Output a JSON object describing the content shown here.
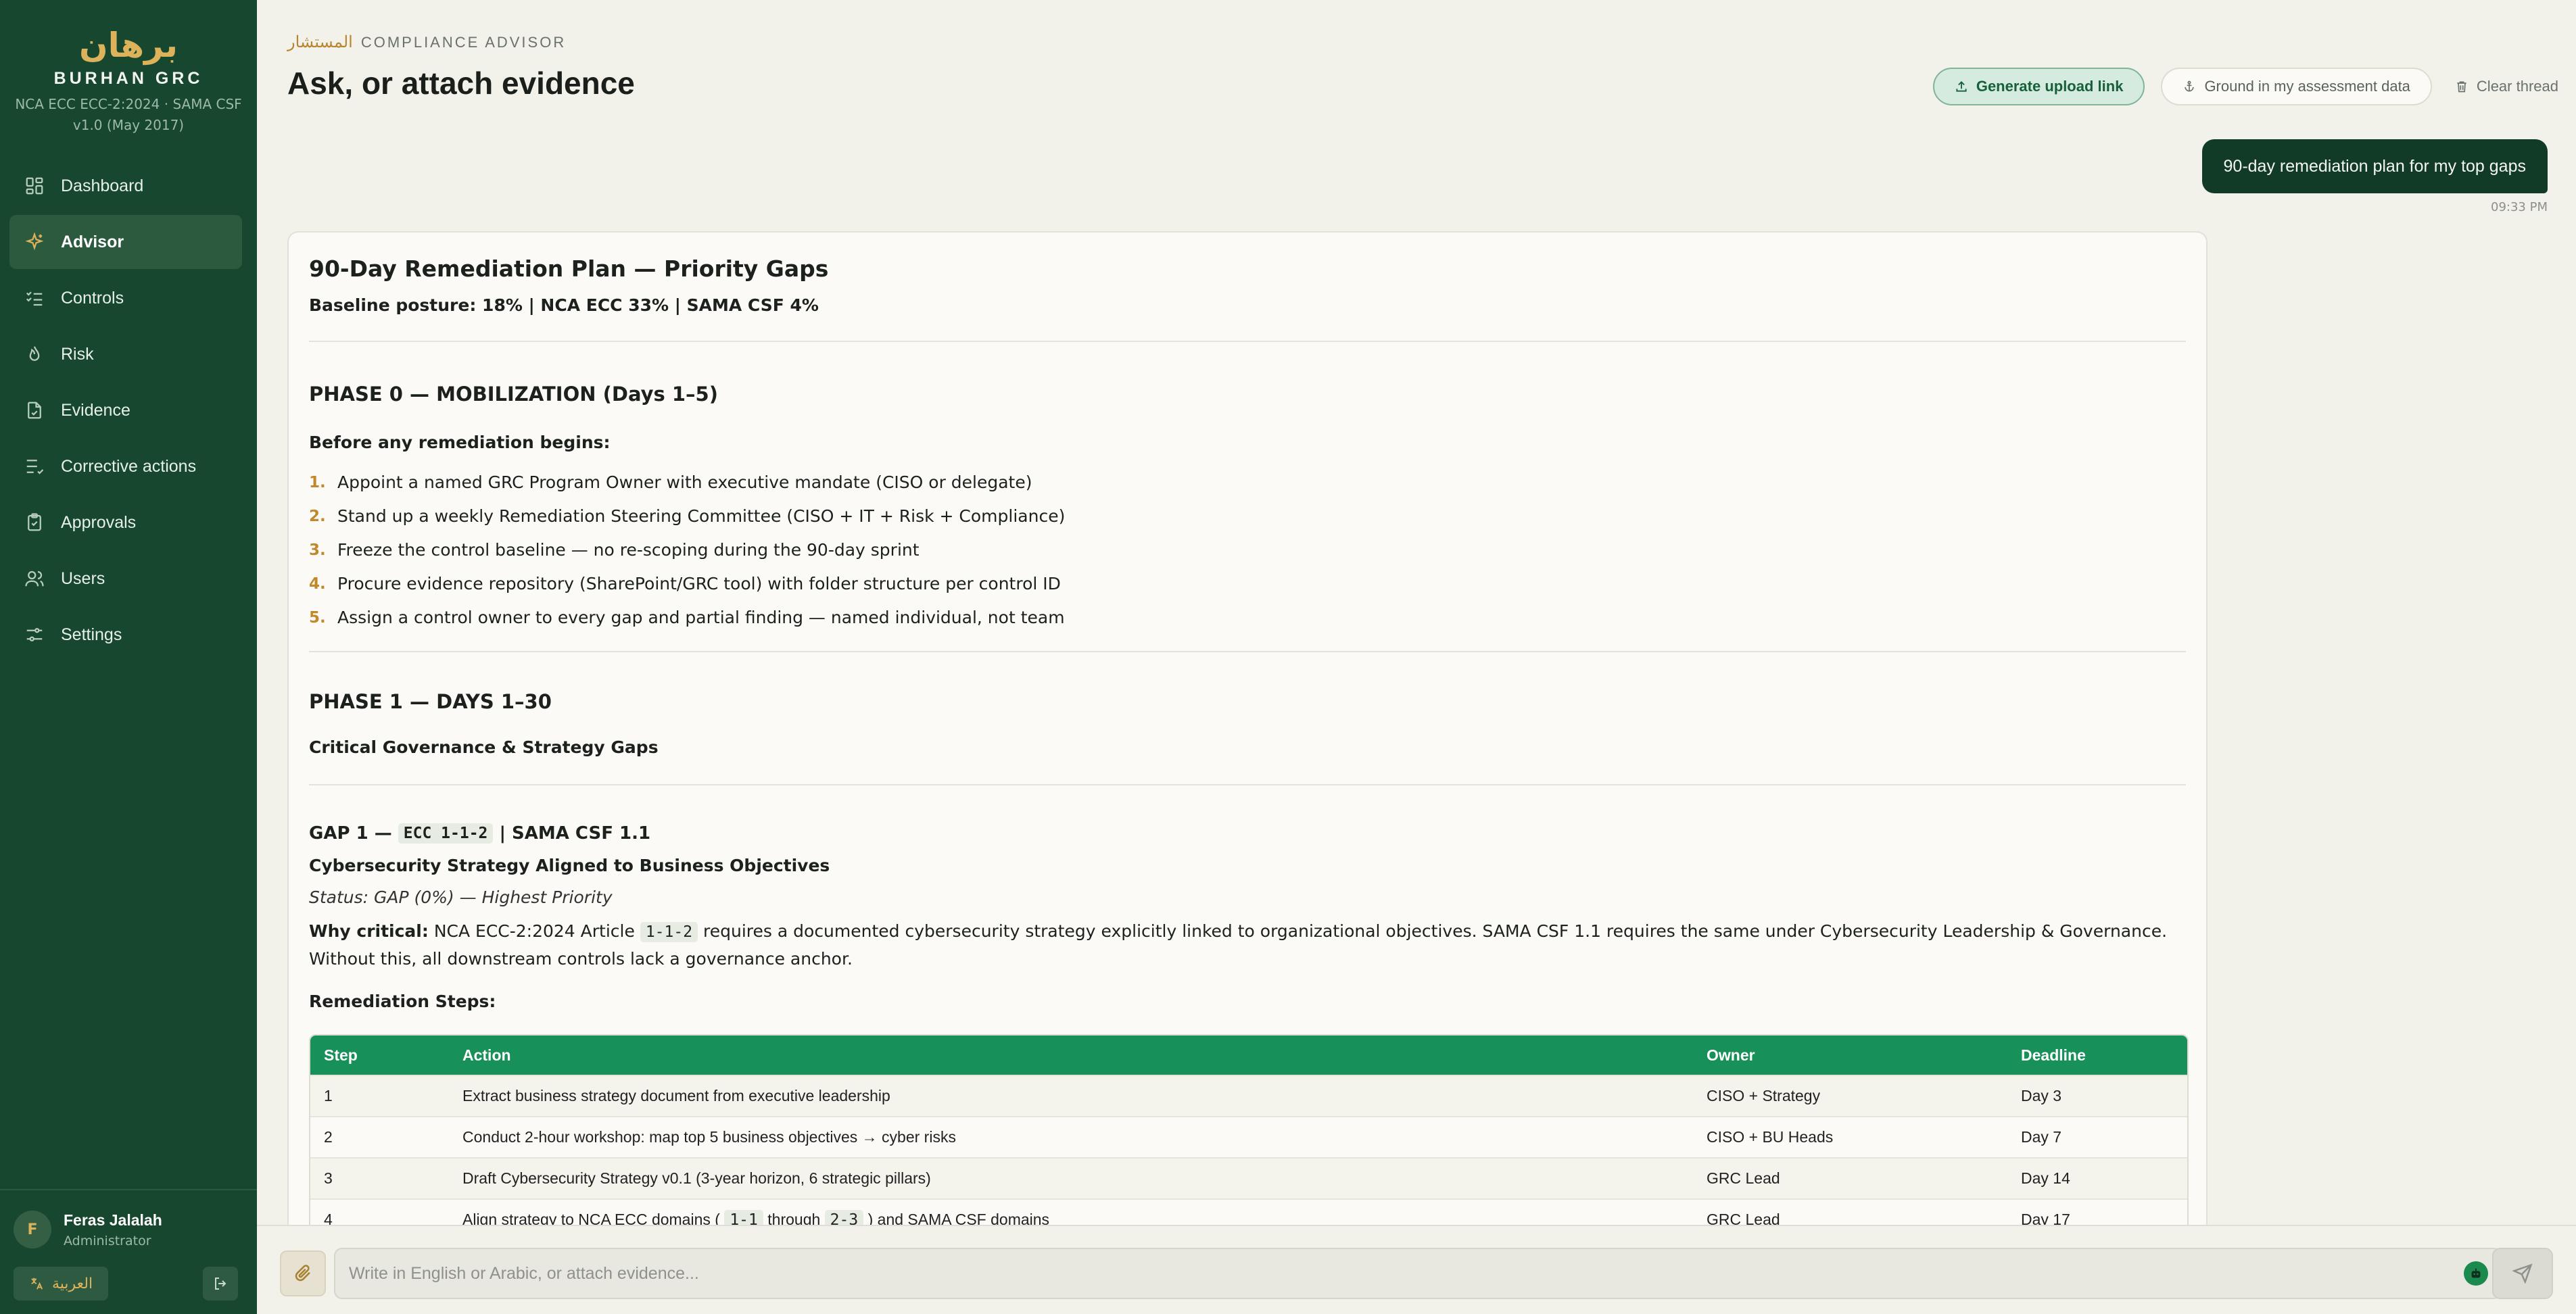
{
  "brand": {
    "arabic": "برهان",
    "name": "BURHAN GRC",
    "frameworks": "NCA ECC ECC-2:2024 · SAMA CSF v1.0 (May 2017)"
  },
  "nav": [
    {
      "label": "Dashboard",
      "icon": "dashboard-icon"
    },
    {
      "label": "Advisor",
      "icon": "sparkle-icon",
      "active": true
    },
    {
      "label": "Controls",
      "icon": "checklist-icon"
    },
    {
      "label": "Risk",
      "icon": "flame-icon"
    },
    {
      "label": "Evidence",
      "icon": "document-icon"
    },
    {
      "label": "Corrective actions",
      "icon": "list-check-icon"
    },
    {
      "label": "Approvals",
      "icon": "clipboard-check-icon"
    },
    {
      "label": "Users",
      "icon": "users-icon"
    },
    {
      "label": "Settings",
      "icon": "sliders-icon"
    }
  ],
  "user": {
    "initial": "F",
    "name": "Feras Jalalah",
    "role": "Administrator"
  },
  "footer": {
    "language_toggle": "العربية"
  },
  "header": {
    "eyebrow_ar": "المستشار",
    "eyebrow": "COMPLIANCE ADVISOR",
    "title": "Ask, or attach evidence",
    "upload_btn": "Generate upload link",
    "ground_btn": "Ground in my assessment data",
    "clear_btn": "Clear thread"
  },
  "chat": {
    "user_message": "90-day remediation plan for my top gaps",
    "user_time": "09:33 PM",
    "reply": {
      "title": "90-Day Remediation Plan — Priority Gaps",
      "baseline": "Baseline posture: 18% | NCA ECC 33% | SAMA CSF 4%",
      "phase0_title": "PHASE 0 — MOBILIZATION (Days 1–5)",
      "phase0_intro": "Before any remediation begins:",
      "phase0_items": [
        "Appoint a named GRC Program Owner with executive mandate (CISO or delegate)",
        "Stand up a weekly Remediation Steering Committee (CISO + IT + Risk + Compliance)",
        "Freeze the control baseline — no re-scoping during the 90-day sprint",
        "Procure evidence repository (SharePoint/GRC tool) with folder structure per control ID",
        "Assign a control owner to every gap and partial finding — named individual, not team"
      ],
      "phase1_title": "PHASE 1 — DAYS 1–30",
      "phase1_sub": "Critical Governance & Strategy Gaps",
      "gap1_prefix": "GAP 1 —",
      "gap1_code": "ECC 1-1-2",
      "gap1_suffix": "| SAMA CSF 1.1",
      "gap1_name": "Cybersecurity Strategy Aligned to Business Objectives",
      "gap1_status": "Status: GAP (0%) — Highest Priority",
      "why_label": "Why critical:",
      "why_a": "NCA ECC-2:2024 Article",
      "why_code": "1-1-2",
      "why_b": "requires a documented cybersecurity strategy explicitly linked to organizational objectives. SAMA CSF 1.1 requires the same under Cybersecurity Leadership & Governance. Without this, all downstream controls lack a governance anchor.",
      "steps_label": "Remediation Steps:",
      "table": {
        "headers": [
          "Step",
          "Action",
          "Owner",
          "Deadline"
        ],
        "rows": [
          {
            "step": "1",
            "action": "Extract business strategy document from executive leadership",
            "owner": "CISO + Strategy",
            "deadline": "Day 3"
          },
          {
            "step": "2",
            "action": "Conduct 2-hour workshop: map top 5 business objectives → cyber risks",
            "owner": "CISO + BU Heads",
            "deadline": "Day 7"
          },
          {
            "step": "3",
            "action": "Draft Cybersecurity Strategy v0.1 (3-year horizon, 6 strategic pillars)",
            "owner": "GRC Lead",
            "deadline": "Day 14"
          },
          {
            "step": "4",
            "action_a": "Align strategy to NCA ECC domains (",
            "code_a": "1-1",
            "action_b": "through",
            "code_b": "2-3",
            "action_c": ") and SAMA CSF domains",
            "owner": "GRC Lead",
            "deadline": "Day 17"
          }
        ]
      }
    }
  },
  "composer": {
    "placeholder": "Write in English or Arabic, or attach evidence..."
  },
  "colors": {
    "sidebar": "#17472f",
    "accent_gold": "#dcb25a",
    "table_header": "#17905a",
    "user_bubble": "#123b27"
  }
}
